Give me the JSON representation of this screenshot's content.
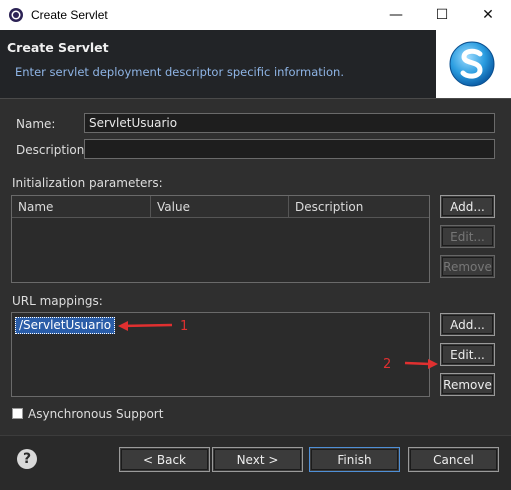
{
  "window": {
    "title": "Create Servlet",
    "minimize": "—",
    "maximize": "☐",
    "close": "✕"
  },
  "banner": {
    "title": "Create Servlet",
    "description": "Enter servlet deployment descriptor specific information."
  },
  "form": {
    "name_label": "Name:",
    "name_value": "ServletUsuario",
    "description_label": "Description:",
    "description_value": ""
  },
  "init_params": {
    "label": "Initialization parameters:",
    "columns": [
      "Name",
      "Value",
      "Description"
    ],
    "buttons": {
      "add": "Add...",
      "edit": "Edit...",
      "remove": "Remove"
    }
  },
  "url_mappings": {
    "label": "URL mappings:",
    "items": [
      "/ServletUsuario"
    ],
    "buttons": {
      "add": "Add...",
      "edit": "Edit...",
      "remove": "Remove"
    }
  },
  "async": {
    "label": "Asynchronous Support",
    "checked": false
  },
  "annotations": {
    "one": "1",
    "two": "2"
  },
  "footer": {
    "back": "< Back",
    "next": "Next >",
    "finish": "Finish",
    "cancel": "Cancel",
    "help": "?"
  },
  "colors": {
    "annotation": "#e03030",
    "selection": "#2a5da8",
    "banner_desc": "#8fb5e6"
  }
}
